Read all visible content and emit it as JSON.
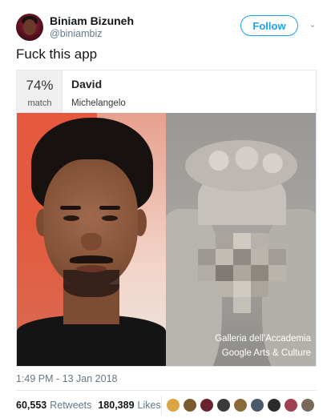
{
  "user": {
    "name": "Biniam Bizuneh",
    "handle": "@biniambiz",
    "follow_label": "Follow",
    "chevron": "⌄"
  },
  "tweet": {
    "text": "Fuck this app",
    "timestamp": "1:49 PM - 13 Jan 2018"
  },
  "card": {
    "match_percent": "74%",
    "match_label": "match",
    "artwork_title": "David",
    "artist": "Michelangelo",
    "caption_line1": "Galleria dell'Accademia",
    "caption_line2": "Google Arts & Culture"
  },
  "stats": {
    "retweets_count": "60,553",
    "retweets_label": "Retweets",
    "likes_count": "180,389",
    "likes_label": "Likes"
  },
  "colors": {
    "accent": "#1da1f2",
    "secondary_text": "#657786",
    "border": "#e1e8ed"
  },
  "icons": {
    "chevron": "chevron-down-icon"
  },
  "liker_avatars": [
    "#d9a441",
    "#7a5a2e",
    "#6b2230",
    "#3b3b3b",
    "#8a6a3a",
    "#4a5a6a",
    "#2b2b2b",
    "#a04050",
    "#7a6a5a"
  ]
}
